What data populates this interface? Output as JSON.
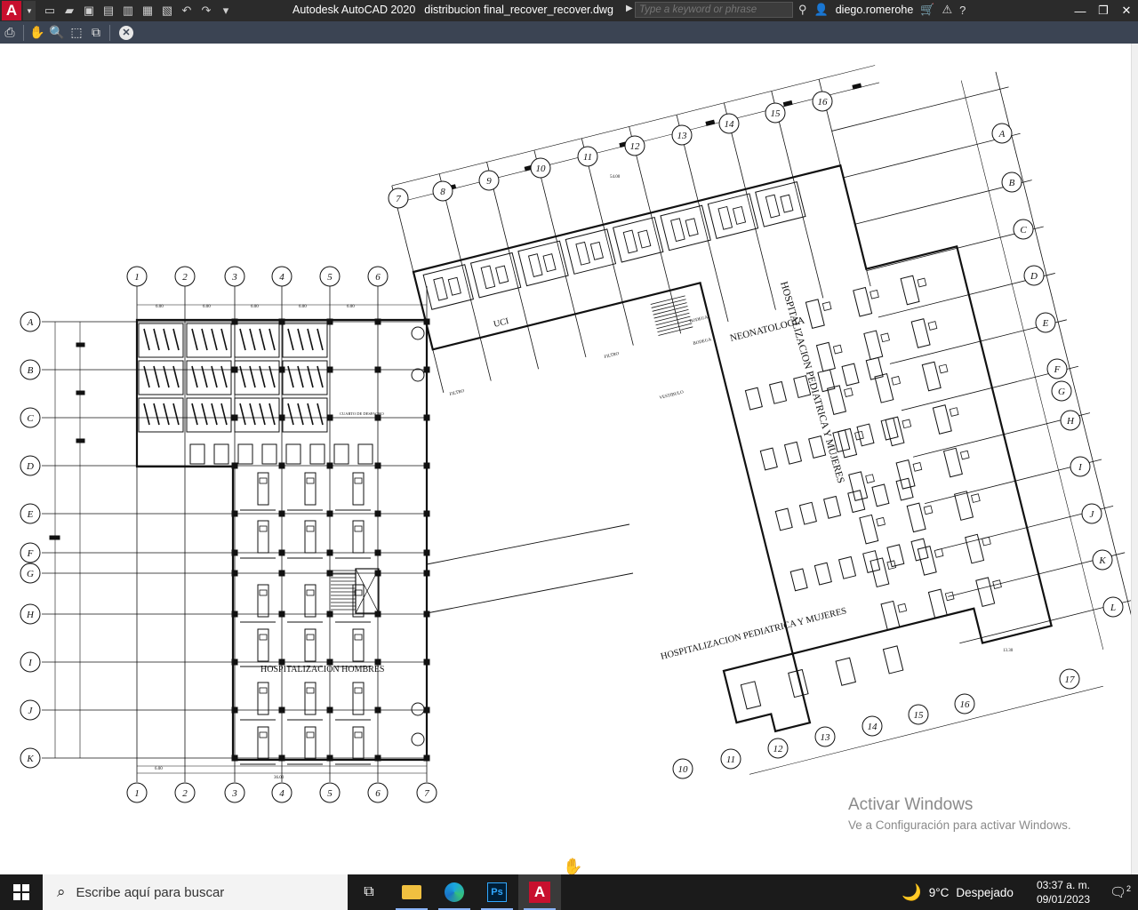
{
  "app": {
    "logo_letter": "A",
    "title": "Autodesk AutoCAD 2020",
    "filename": "distribucion final_recover_recover.dwg",
    "search_placeholder": "Type a keyword or phrase",
    "user": "diego.romerohe",
    "help": "?"
  },
  "drawing": {
    "labels": {
      "hosp_hombres": "HOSPITALIZACION HOMBRES",
      "hosp_ped_mujeres_1": "HOSPITALIZACION PEDIATRICA Y MUJERES",
      "hosp_ped_mujeres_2": "HOSPITALIZACION PEDIATRICA Y MUJERES",
      "neonatologia": "NEONATOLOGIA",
      "uci": "UCI",
      "filtro_1": "FILTRO",
      "filtro_2": "FILTRO",
      "vestibulo": "VESTIBULO",
      "bodega_1": "BODEGA",
      "bodega_2": "BODEGA",
      "cuarto": "CUARTO DE DESPACHO"
    },
    "left_grid_letters": [
      "A",
      "B",
      "C",
      "D",
      "E",
      "F",
      "G",
      "H",
      "I",
      "J",
      "K"
    ],
    "left_grid_numbers": [
      "1",
      "2",
      "3",
      "4",
      "5",
      "6",
      "7"
    ],
    "right_grid_letters": [
      "A",
      "B",
      "C",
      "D",
      "E",
      "F",
      "G",
      "H",
      "I",
      "J",
      "K",
      "L"
    ],
    "right_top_numbers": [
      "7",
      "8",
      "9",
      "10",
      "11",
      "12",
      "13",
      "14",
      "15",
      "16"
    ],
    "right_bottom_numbers": [
      "10",
      "11",
      "12",
      "13",
      "14",
      "15",
      "16",
      "17"
    ],
    "dims": [
      "6.00",
      "6.00",
      "6.00",
      "6.00",
      "6.00",
      "6.00",
      "36.00",
      "13.30",
      "54.00"
    ]
  },
  "watermark": {
    "line1": "Activar Windows",
    "line2": "Ve a Configuración para activar Windows."
  },
  "taskbar": {
    "search_placeholder": "Escribe aquí para buscar",
    "weather_temp": "9°C",
    "weather_desc": "Despejado",
    "time": "03:37 a. m.",
    "date": "09/01/2023",
    "notif_count": "2",
    "ps_label": "Ps",
    "acad_label": "A"
  }
}
